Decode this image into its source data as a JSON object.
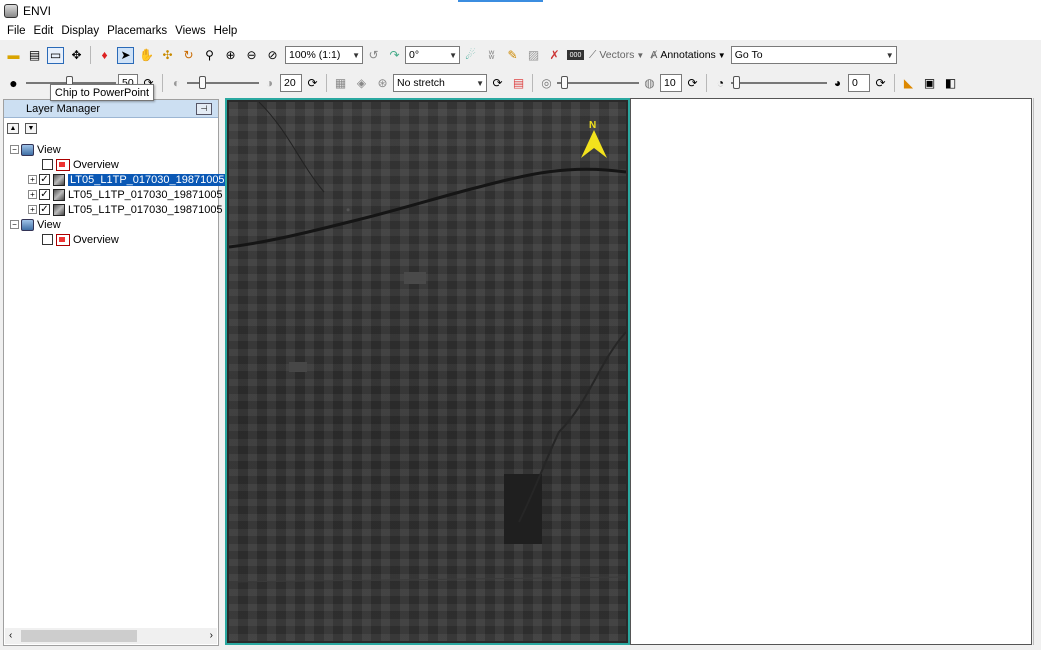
{
  "window": {
    "title": "ENVI"
  },
  "menu": [
    "File",
    "Edit",
    "Display",
    "Placemarks",
    "Views",
    "Help"
  ],
  "toolbar1": {
    "zoom_value": "100% (1:1)",
    "rotation_value": "0°",
    "vectors_label": "Vectors",
    "annotations_label": "Annotations",
    "goto_value": "Go To"
  },
  "toolbar2": {
    "brightness_value": "50",
    "contrast_value": "20",
    "stretch_value": "No stretch",
    "sharpen_value": "10",
    "transparency_value": "0"
  },
  "tooltip": "Chip to PowerPoint",
  "layer_manager": {
    "title": "Layer Manager",
    "tree": [
      {
        "label": "View",
        "kind": "view"
      },
      {
        "label": "Overview",
        "kind": "overview",
        "checked": false
      },
      {
        "label": "LT05_L1TP_017030_19871005",
        "kind": "raster",
        "checked": true,
        "selected": true
      },
      {
        "label": "LT05_L1TP_017030_19871005",
        "kind": "raster",
        "checked": true
      },
      {
        "label": "LT05_L1TP_017030_19871005",
        "kind": "raster",
        "checked": true
      },
      {
        "label": "View",
        "kind": "view"
      },
      {
        "label": "Overview",
        "kind": "overview",
        "checked": false
      }
    ]
  },
  "view": {
    "north_label": "N"
  },
  "colors": {
    "view_border": "#2aa8a0",
    "selection": "#0a58b5",
    "north_arrow": "#f2e21d"
  }
}
